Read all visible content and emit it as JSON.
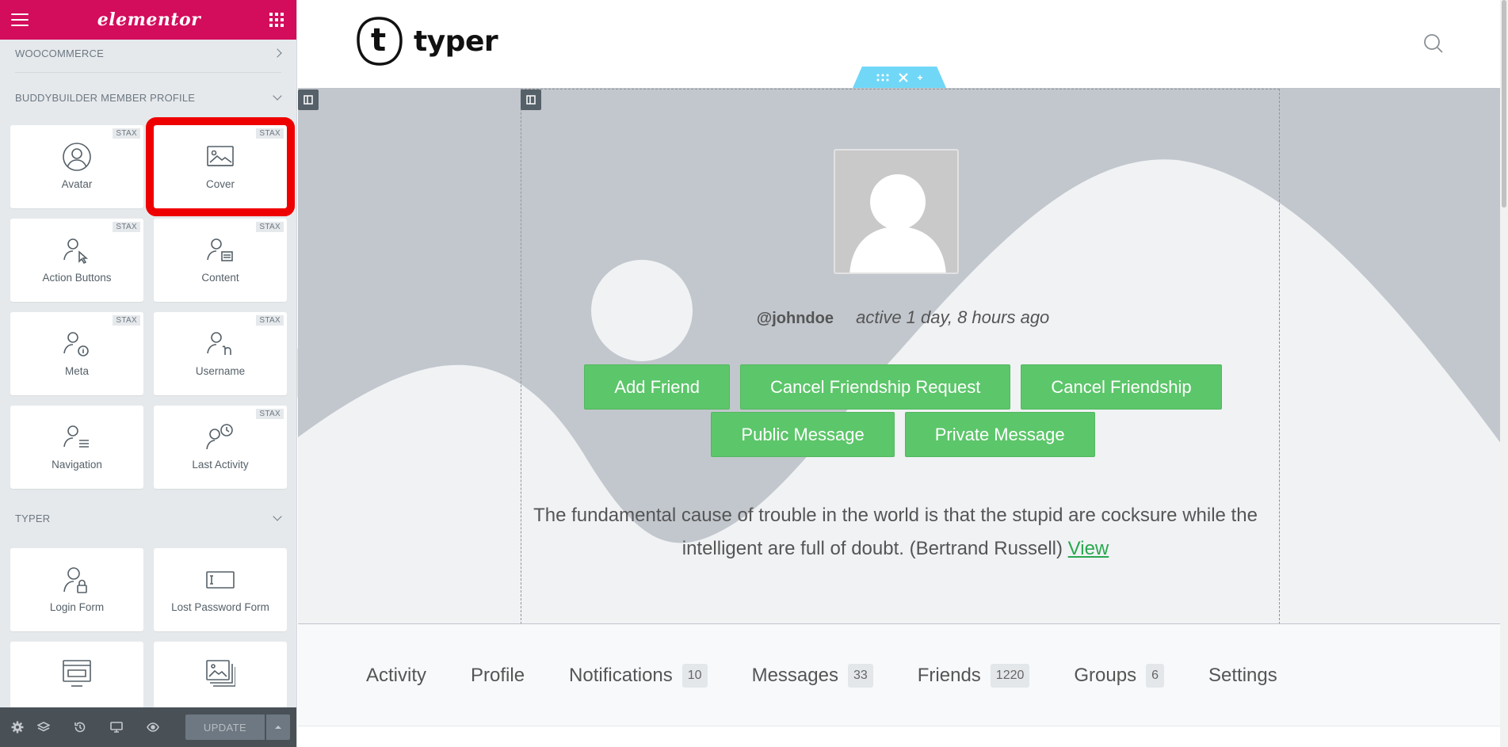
{
  "panel": {
    "brand": "elementor",
    "categories": [
      {
        "label": "WOOCOMMERCE"
      },
      {
        "label": "BUDDYBUILDER MEMBER PROFILE"
      },
      {
        "label": "TYPER"
      }
    ],
    "badge": "STAX",
    "member_widgets": [
      {
        "label": "Avatar",
        "icon": "avatar-icon"
      },
      {
        "label": "Cover",
        "icon": "cover-image-icon"
      },
      {
        "label": "Action Buttons",
        "icon": "action-buttons-icon"
      },
      {
        "label": "Content",
        "icon": "content-icon"
      },
      {
        "label": "Meta",
        "icon": "meta-icon"
      },
      {
        "label": "Username",
        "icon": "username-icon"
      },
      {
        "label": "Navigation",
        "icon": "navigation-icon"
      },
      {
        "label": "Last Activity",
        "icon": "last-activity-icon"
      }
    ],
    "typer_widgets": [
      {
        "label": "Login Form",
        "icon": "login-form-icon"
      },
      {
        "label": "Lost Password Form",
        "icon": "lost-password-icon"
      }
    ],
    "footer": {
      "update_label": "UPDATE"
    }
  },
  "site": {
    "brand": "typer",
    "logo_letter": "t"
  },
  "profile": {
    "username": "@johndoe",
    "last_active": "active 1 day, 8 hours ago",
    "buttons_row1": [
      "Add Friend",
      "Cancel Friendship Request",
      "Cancel Friendship"
    ],
    "buttons_row2": [
      "Public Message",
      "Private Message"
    ],
    "quote": "The fundamental cause of trouble in the world is that the stupid are cocksure while the intelligent are full of doubt. (Bertrand Russell)",
    "quote_link": "View"
  },
  "member_nav": [
    {
      "label": "Activity",
      "count": ""
    },
    {
      "label": "Profile",
      "count": ""
    },
    {
      "label": "Notifications",
      "count": "10"
    },
    {
      "label": "Messages",
      "count": "33"
    },
    {
      "label": "Friends",
      "count": "1220"
    },
    {
      "label": "Groups",
      "count": "6"
    },
    {
      "label": "Settings",
      "count": ""
    }
  ],
  "colors": {
    "elementor_pink": "#d30c5c",
    "button_green": "#5cc66a",
    "highlight_red": "#ef0000",
    "handle_blue": "#71d7f7"
  }
}
